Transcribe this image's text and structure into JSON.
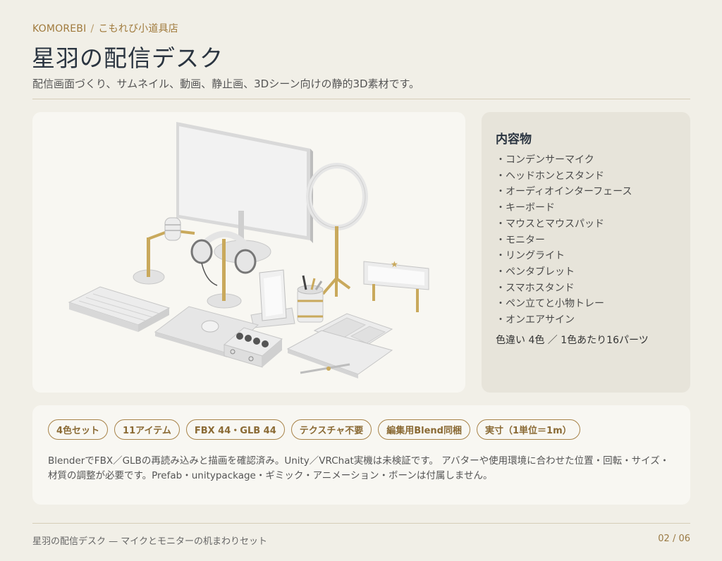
{
  "header": {
    "brand": "KOMOREBI",
    "separator": "/",
    "shop": "こもれび小道具店",
    "title": "星羽の配信デスク",
    "subtitle": "配信画面づくり、サムネイル、動画、静止画、3Dシーン向けの静的3D素材です。"
  },
  "contents": {
    "title": "内容物",
    "items": [
      "コンデンサーマイク",
      "ヘッドホンとスタンド",
      "オーディオインターフェース",
      "キーボード",
      "マウスとマウスパッド",
      "モニター",
      "リングライト",
      "ペンタブレット",
      "スマホスタンド",
      "ペン立てと小物トレー",
      "オンエアサイン"
    ],
    "note": "色違い 4色 ／ 1色あたり16パーツ"
  },
  "info": {
    "tags": [
      "4色セット",
      "11アイテム",
      "FBX 44・GLB 44",
      "テクスチャ不要",
      "編集用Blend同梱",
      "実寸（1単位＝1m）"
    ],
    "line1": "BlenderでFBX／GLBの再読み込みと描画を確認済み。Unity／VRChat実機は未検証です。 アバターや使用環境に合わせた位置・回転・サイズ・",
    "line2": "材質の調整が必要です。Prefab・unitypackage・ギミック・アニメーション・ボーンは付属しません。"
  },
  "footer": {
    "left": "星羽の配信デスク — マイクとモニターの机まわりセット",
    "page": "02 / 06"
  },
  "colors": {
    "accent": "#a07a3c",
    "gold": "#c9a95c",
    "background": "#f1efe7"
  }
}
